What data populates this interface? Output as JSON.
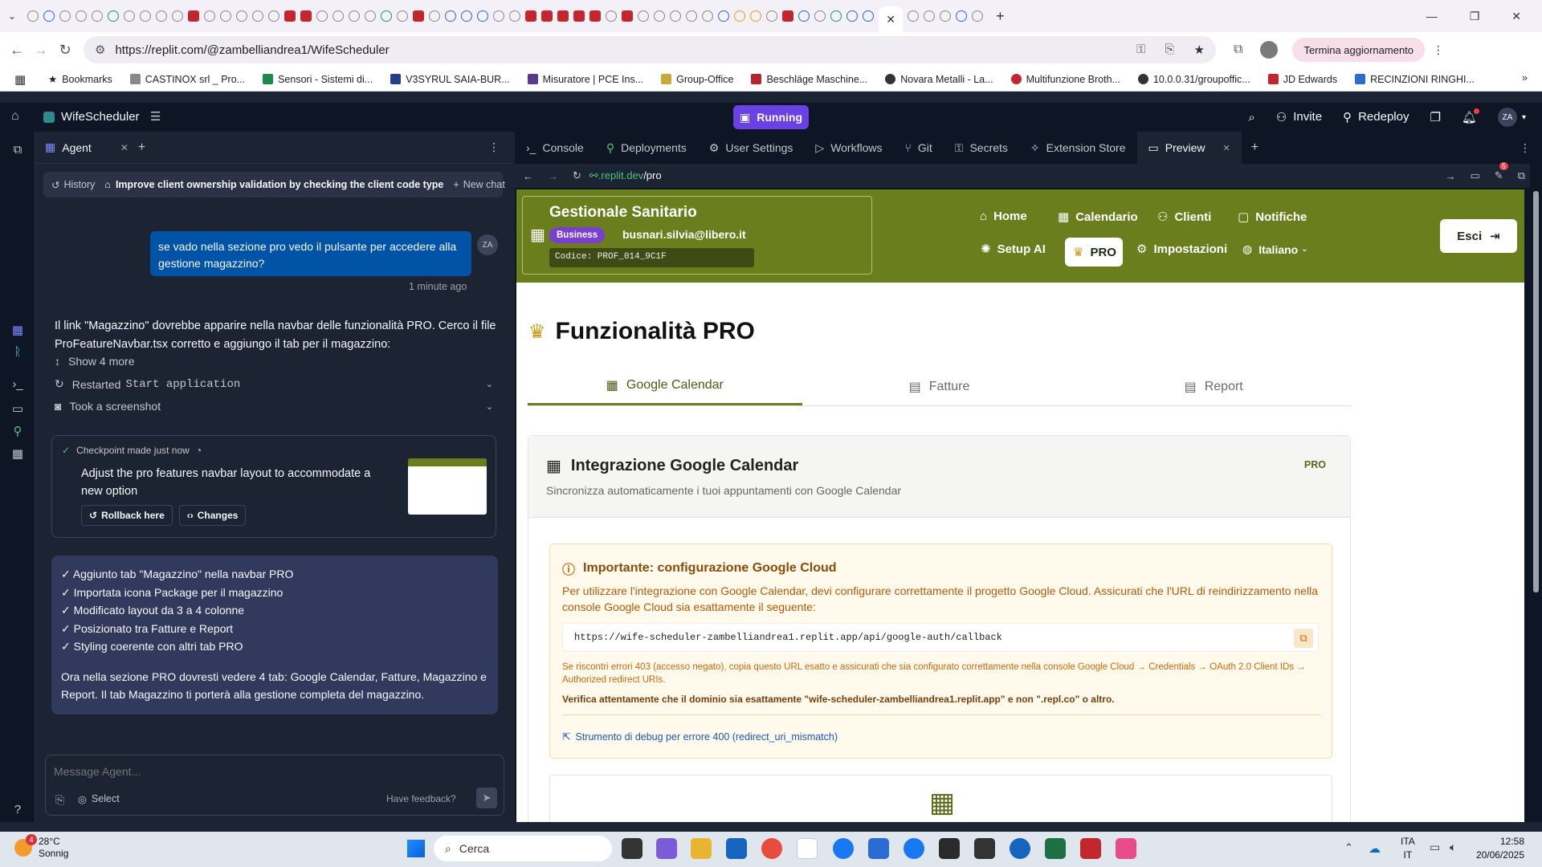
{
  "browser": {
    "url": "https://replit.com/@zambelliandrea1/WifeScheduler",
    "update_button": "Termina aggiornamento",
    "bookmarks": [
      "Bookmarks",
      "CASTINOX srl _ Pro...",
      "Sensori - Sistemi di...",
      "V3SYRUL SAIA-BUR...",
      "Misuratore | PCE Ins...",
      "Group-Office",
      "Beschläge Maschine...",
      "Novara Metalli - La...",
      "Multifunzione Broth...",
      "10.0.0.31/groupoffic...",
      "JD Edwards",
      "RECINZIONI RINGHI..."
    ]
  },
  "replit": {
    "project_name": "WifeScheduler",
    "run_status": "Running",
    "invite": "Invite",
    "redeploy": "Redeploy",
    "avatar": "ZA"
  },
  "agent": {
    "tab_label": "Agent",
    "history": "History",
    "chat_title": "Improve client ownership validation by checking the client code type",
    "new_chat": "New chat",
    "user_message": "se vado nella sezione pro vedo il pulsante per accedere alla gestione magazzino?",
    "user_avatar": "ZA",
    "message_time": "1 minute ago",
    "reply_text": "Il link \"Magazzino\" dovrebbe apparire nella navbar delle funzionalità PRO. Cerco il file ProFeatureNavbar.tsx corretto e aggiungo il tab per il magazzino:",
    "show_more": "Show 4 more",
    "restarted_prefix": "Restarted",
    "restarted_cmd": "Start application",
    "screenshot": "Took a screenshot",
    "checkpoint_label": "Checkpoint made just now",
    "checkpoint_title": "Adjust the pro features navbar layout to accommodate a new option",
    "rollback": "Rollback here",
    "changes": "Changes",
    "summary_items": [
      "✓ Aggiunto tab \"Magazzino\" nella navbar PRO",
      "✓ Importata icona Package per il magazzino",
      "✓ Modificato layout da 3 a 4 colonne",
      "✓ Posizionato tra Fatture e Report",
      "✓ Styling coerente con altri tab PRO"
    ],
    "summary_text": "Ora nella sezione PRO dovresti vedere 4 tab: Google Calendar, Fatture, Magazzino e Report. Il tab Magazzino ti porterà alla gestione completa del magazzino.",
    "input_placeholder": "Message Agent...",
    "select_label": "Select",
    "feedback": "Have feedback?"
  },
  "workspace": {
    "tabs": [
      "Console",
      "Deployments",
      "User Settings",
      "Workflows",
      "Git",
      "Secrets",
      "Extension Store",
      "Preview"
    ],
    "preview_url_host": ".replit.dev",
    "preview_url_path": "/pro",
    "notif_count": "5"
  },
  "app": {
    "brand": "Gestionale Sanitario",
    "plan_badge": "Business",
    "email": "busnari.silvia@libero.it",
    "code": "Codice: PROF_014_9C1F",
    "nav": {
      "home": "Home",
      "calendario": "Calendario",
      "clienti": "Clienti",
      "notifiche": "Notifiche",
      "setup_ai": "Setup AI",
      "pro": "PRO",
      "impostazioni": "Impostazioni",
      "lingua": "Italiano"
    },
    "logout": "Esci",
    "page_title": "Funzionalità PRO",
    "tabs": [
      "Google Calendar",
      "Fatture",
      "Report"
    ],
    "card_title": "Integrazione Google Calendar",
    "card_subtitle": "Sincronizza automaticamente i tuoi appuntamenti con Google Calendar",
    "card_badge": "PRO",
    "warn_title": "Importante: configurazione Google Cloud",
    "warn_text": "Per utilizzare l'integrazione con Google Calendar, devi configurare correttamente il progetto Google Cloud. Assicurati che l'URL di reindirizzamento nella console Google Cloud sia esattamente il seguente:",
    "callback_url": "https://wife-scheduler-zambelliandrea1.replit.app/api/google-auth/callback",
    "warn_403": "Se riscontri errori 403 (accesso negato), copia questo URL esatto e assicurati che sia configurato correttamente nella console Google Cloud → Credentials → OAuth 2.0 Client IDs → Authorized redirect URIs.",
    "warn_verify": "Verifica attentamente che il dominio sia esattamente \"wife-scheduler-zambelliandrea1.replit.app\" e non \".repl.co\" o altro.",
    "debug_link": "Strumento di debug per errore 400 (redirect_uri_mismatch)"
  },
  "taskbar": {
    "weather_temp": "28°C",
    "weather_desc": "Sonnig",
    "weather_badge": "4",
    "search": "Cerca",
    "lang_top": "ITA",
    "lang_bottom": "IT",
    "time": "12:58",
    "date": "20/06/2025"
  }
}
